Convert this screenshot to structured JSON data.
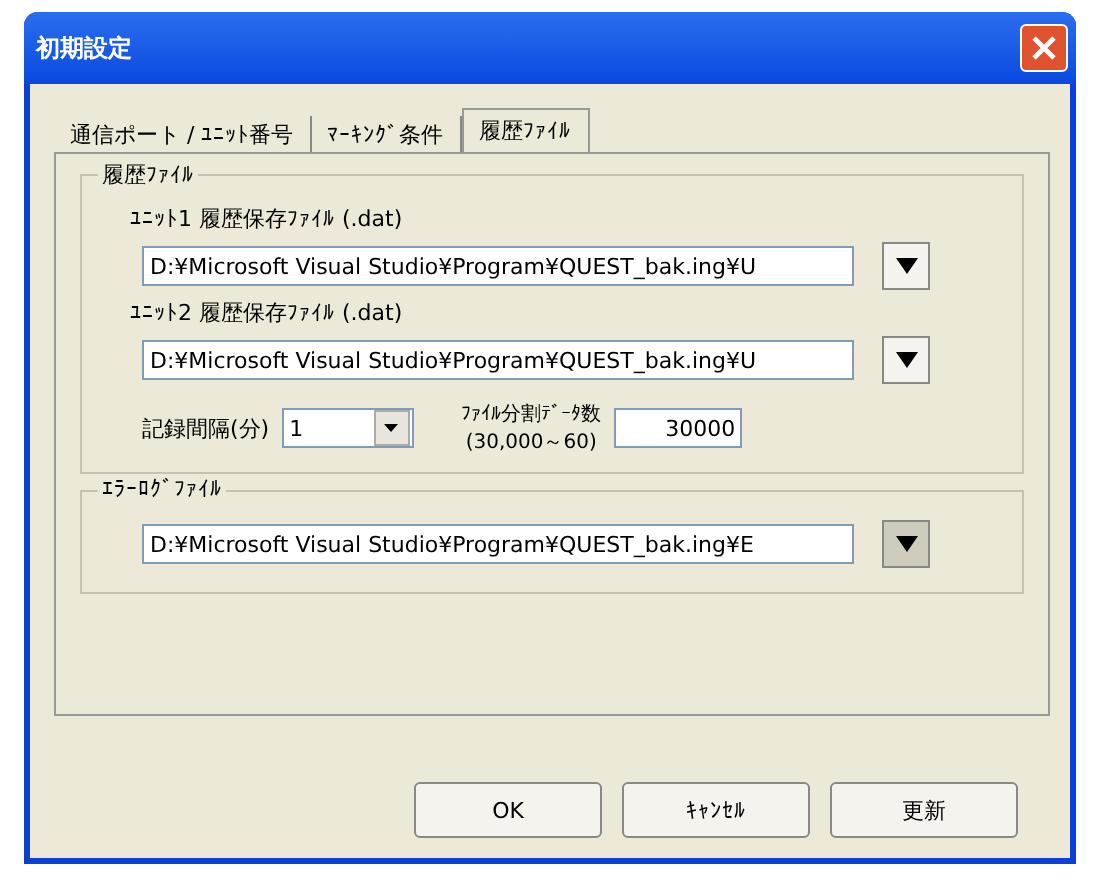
{
  "window": {
    "title": "初期設定"
  },
  "tabs": [
    {
      "label": "通信ポート / ﾕﾆｯﾄ番号",
      "selected": false
    },
    {
      "label": "ﾏｰｷﾝｸﾞ条件",
      "selected": false
    },
    {
      "label": "履歴ﾌｧｲﾙ",
      "selected": true
    }
  ],
  "history_group": {
    "title": "履歴ﾌｧｲﾙ",
    "files": [
      {
        "label": "ﾕﾆｯﾄ1 履歴保存ﾌｧｲﾙ (.dat)",
        "value": "D:¥Microsoft Visual Studio¥Program¥QUEST_bak.ing¥U"
      },
      {
        "label": "ﾕﾆｯﾄ2 履歴保存ﾌｧｲﾙ (.dat)",
        "value": "D:¥Microsoft Visual Studio¥Program¥QUEST_bak.ing¥U"
      }
    ],
    "interval": {
      "label": "記録間隔(分)",
      "value": "1"
    },
    "split": {
      "label": "ﾌｧｲﾙ分割ﾃﾞｰﾀ数",
      "range": "(30,000～60)",
      "value": "30000"
    }
  },
  "error_group": {
    "title": "ｴﾗｰﾛｸﾞﾌｧｲﾙ",
    "value": "D:¥Microsoft Visual Studio¥Program¥QUEST_bak.ing¥E"
  },
  "buttons": [
    "OK",
    "ｷｬﾝｾﾙ",
    "更新"
  ]
}
